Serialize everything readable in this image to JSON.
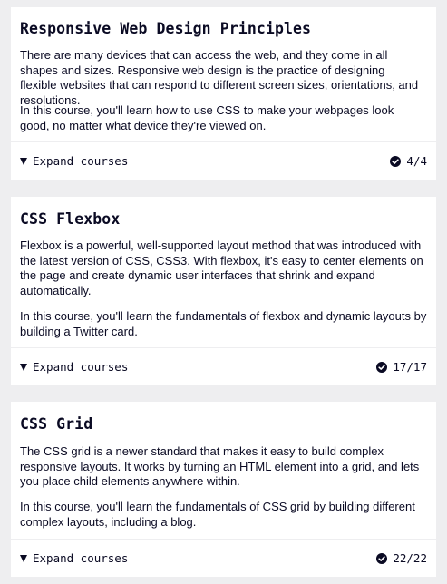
{
  "cards": [
    {
      "title": "Responsive Web Design Principles",
      "paragraphs": [
        "There are many devices that can access the web, and they come in all shapes and sizes. Responsive web design is the practice of designing flexible websites that can respond to different screen sizes, orientations, and resolutions.",
        "In this course, you'll learn how to use CSS to make your webpages look good, no matter what device they're viewed on."
      ],
      "expand_label": "Expand courses",
      "progress": "4/4",
      "completed": 4,
      "total": 4
    },
    {
      "title": "CSS Flexbox",
      "paragraphs": [
        "Flexbox is a powerful, well-supported layout method that was introduced with the latest version of CSS, CSS3. With flexbox, it's easy to center elements on the page and create dynamic user interfaces that shrink and expand automatically.",
        "In this course, you'll learn the fundamentals of flexbox and dynamic layouts by building a Twitter card."
      ],
      "expand_label": "Expand courses",
      "progress": "17/17",
      "completed": 17,
      "total": 17
    },
    {
      "title": "CSS Grid",
      "paragraphs": [
        "The CSS grid is a newer standard that makes it easy to build complex responsive layouts. It works by turning an HTML element into a grid, and lets you place child elements anywhere within.",
        "In this course, you'll learn the fundamentals of CSS grid by building different complex layouts, including a blog."
      ],
      "expand_label": "Expand courses",
      "progress": "22/22",
      "completed": 22,
      "total": 22
    }
  ],
  "icons": {
    "expand": "caret-down-icon",
    "complete": "check-circle-icon"
  }
}
